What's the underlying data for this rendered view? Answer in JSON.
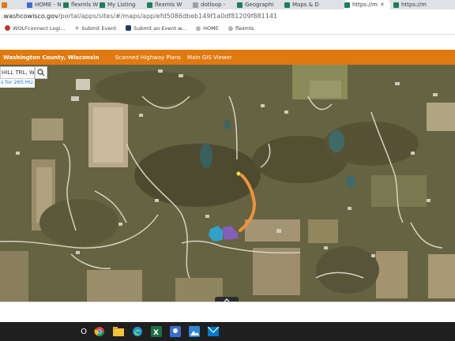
{
  "browser": {
    "tabs": [
      {
        "label": "HOME - N",
        "color": "#3b6fd1"
      },
      {
        "label": "flexmls W",
        "color": "#1a7f5a"
      },
      {
        "label": "My Listing",
        "color": "#1a7f5a"
      },
      {
        "label": "flexmls W",
        "color": "#1a7f5a"
      },
      {
        "label": "dotloop -",
        "color": "#e8eaed"
      },
      {
        "label": "Geographi",
        "color": "#1a7f5a"
      },
      {
        "label": "Maps & D",
        "color": "#1a7f5a"
      },
      {
        "label": "https://m",
        "color": "#1a7f5a"
      },
      {
        "label": "https://m",
        "color": "#1a7f5a"
      }
    ],
    "address": {
      "domain": ".washcowisco.gov",
      "path": "/portal/apps/sites/#/maps/app/efd5086dbeb149f1a0df81209f881141"
    },
    "bookmarks": [
      {
        "label": "WOLFconnect Logi...",
        "color": "#c0392b"
      },
      {
        "label": "Submit Event",
        "color": "#8a8a8a"
      },
      {
        "label": "Submit an Event w...",
        "color": "#1e3a6b"
      },
      {
        "label": "HOME",
        "color": "#555555"
      },
      {
        "label": "flexmls",
        "color": "#555555"
      }
    ]
  },
  "app": {
    "title": "Washington County, Wisconsin",
    "nav": [
      "Scanned Highway Plans",
      "Main GIS Viewer"
    ],
    "accent": "#e07a10"
  },
  "search": {
    "value": "HILL TRL, W",
    "suggestion": "s for 265 HU..."
  },
  "map": {
    "route_color": "#f0923a",
    "parcel_blue": "#2aa7d8",
    "parcel_purple": "#8a5cc8"
  },
  "taskbar": {
    "search_glyph": "O",
    "apps": [
      "task-view",
      "chrome",
      "file-explorer",
      "edge",
      "excel",
      "maps",
      "photos",
      "mail"
    ]
  }
}
